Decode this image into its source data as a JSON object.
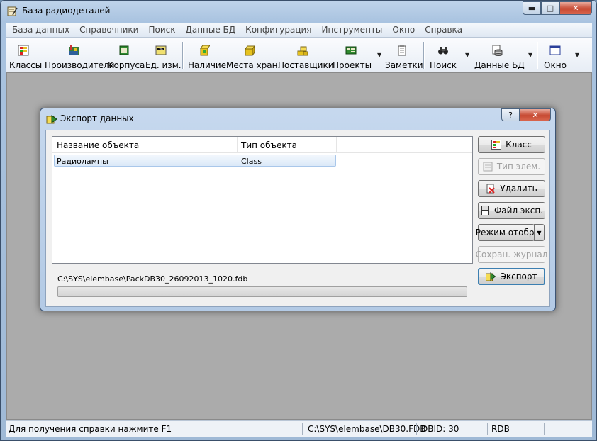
{
  "window": {
    "title": "База радиодеталей",
    "caption": {
      "minimize": "▬",
      "maximize": "□",
      "close": "✕"
    }
  },
  "menu": [
    "База данных",
    "Справочники",
    "Поиск",
    "Данные БД",
    "Конфигурация",
    "Инструменты",
    "Окно",
    "Справка"
  ],
  "toolbar": {
    "classes": "Классы",
    "manufacturers": "Производители",
    "packages": "Корпуса",
    "units": "Ед. изм.",
    "stock": "Наличие",
    "storage": "Места хран.",
    "suppliers": "Поставщики",
    "projects": "Проекты",
    "notes": "Заметки",
    "search": "Поиск",
    "dbdata": "Данные БД",
    "window": "Окно",
    "dropdown_glyph": "▼"
  },
  "dialog": {
    "title": "Экспорт данных",
    "help_glyph": "?",
    "close_glyph": "✕",
    "columns": [
      "Название объекта",
      "Тип объекта"
    ],
    "rows": [
      {
        "name": "Радиолампы",
        "type": "Class"
      }
    ],
    "path": "C:\\SYS\\elembase\\PackDB30_26092013_1020.fdb",
    "progress": 0,
    "buttons": {
      "class": "Класс",
      "elem_type": "Тип элем.",
      "delete": "Удалить",
      "export_file": "Файл эксп.",
      "display_mode": "Режим отобр.",
      "save_log": "Сохран. журнал",
      "export": "Экспорт"
    }
  },
  "status": {
    "help": "Для получения справки нажмите F1",
    "db_path": "C:\\SYS\\elembase\\DB30.FDB",
    "dbid": "DBID: 30",
    "mode": "RDB"
  },
  "colors": {
    "client_background": "#ababab",
    "selected_row": "#dbe9f8",
    "close_button": "#c74a33"
  }
}
